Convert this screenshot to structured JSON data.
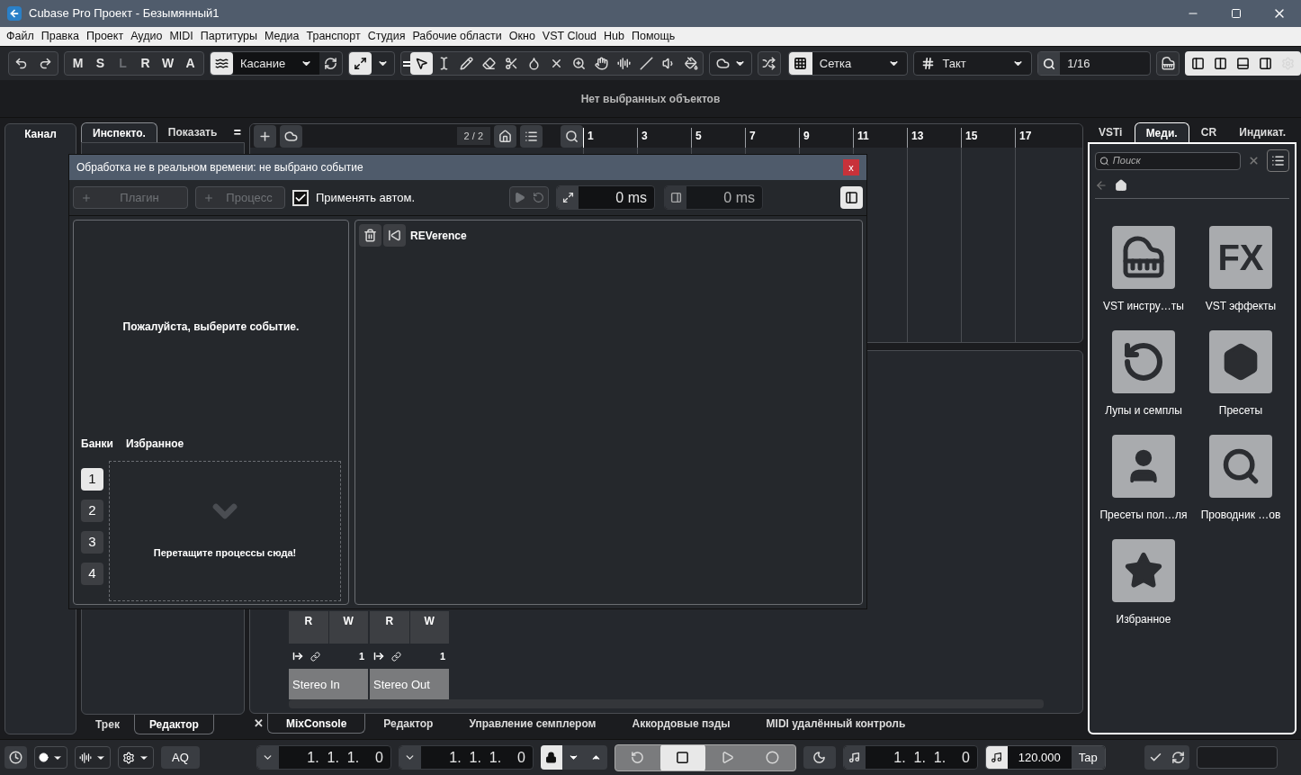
{
  "window": {
    "title": "Cubase Pro Проект - Безымянный1"
  },
  "menu": [
    "Файл",
    "Правка",
    "Проект",
    "Аудио",
    "MIDI",
    "Партитуры",
    "Медиа",
    "Транспорт",
    "Студия",
    "Рабочие области",
    "Окно",
    "VST Cloud",
    "Hub",
    "Помощь"
  ],
  "toolbar": {
    "modes": [
      {
        "label": "M",
        "disabled": false
      },
      {
        "label": "S",
        "disabled": false
      },
      {
        "label": "L",
        "disabled": true
      },
      {
        "label": "R",
        "disabled": false
      },
      {
        "label": "W",
        "disabled": false
      },
      {
        "label": "A",
        "disabled": false
      }
    ],
    "automation_mode": "Касание",
    "snap_type": "Сетка",
    "grid": "Такт",
    "quantize": "1/16"
  },
  "info_line": "Нет выбранных объектов",
  "channel_tab": "Канал",
  "inspector": {
    "tabs": [
      {
        "label": "Инспекто.",
        "selected": true
      },
      {
        "label": "Показать",
        "selected": false
      }
    ],
    "menu_glyph": "="
  },
  "left_zone_tabs": [
    {
      "label": "Трек",
      "selected": false
    },
    {
      "label": "Редактор",
      "selected": true
    }
  ],
  "project": {
    "track_count": "2 / 2",
    "ruler": [
      "1",
      "3",
      "5",
      "7",
      "9",
      "11",
      "13",
      "15",
      "17"
    ]
  },
  "mixer": {
    "strips": [
      {
        "name": "Stereo In",
        "read": "R",
        "write": "W",
        "channels": "1"
      },
      {
        "name": "Stereo Out",
        "read": "R",
        "write": "W",
        "channels": "1"
      }
    ]
  },
  "lower_zone": {
    "close_glyph": "✕",
    "tabs": [
      {
        "label": "MixConsole",
        "selected": true
      },
      {
        "label": "Редактор",
        "selected": false
      },
      {
        "label": "Управление семплером",
        "selected": false
      },
      {
        "label": "Аккордовые пэды",
        "selected": false
      },
      {
        "label": "MIDI удалённый контроль",
        "selected": false
      }
    ]
  },
  "media_bay": {
    "tabs": [
      {
        "label": "VSTi",
        "selected": false
      },
      {
        "label": "Меди.",
        "selected": true
      },
      {
        "label": "CR",
        "selected": false
      },
      {
        "label": "Индикат.",
        "selected": false
      }
    ],
    "search": {
      "placeholder": "Поиск"
    },
    "effects_glyph": "FX",
    "items": [
      {
        "kind": "instruments",
        "label": "VST инстру…ты"
      },
      {
        "kind": "effects",
        "label": "VST эффекты"
      },
      {
        "kind": "loops",
        "label": "Лупы и семплы"
      },
      {
        "kind": "presets",
        "label": "Пресеты"
      },
      {
        "kind": "user_presets",
        "label": "Пресеты пол…ля"
      },
      {
        "kind": "browser",
        "label": "Проводник …ов"
      },
      {
        "kind": "favorites",
        "label": "Избранное"
      }
    ]
  },
  "dialog": {
    "title": "Обработка не в реальном времени: не выбрано событие",
    "close_glyph": "x",
    "buttons": [
      {
        "label": "Плагин",
        "disabled": true
      },
      {
        "label": "Процесс",
        "disabled": true
      }
    ],
    "auto_apply": {
      "label": "Применять автом.",
      "checked": true
    },
    "pre_roll": "0 ms",
    "post_roll": "0 ms",
    "message": "Пожалуйста, выберите событие.",
    "bank_tabs": [
      "Банки",
      "Избранное"
    ],
    "banks": [
      {
        "label": "1",
        "selected": true
      },
      {
        "label": "2",
        "selected": false
      },
      {
        "label": "3",
        "selected": false
      },
      {
        "label": "4",
        "selected": false
      }
    ],
    "drop_hint": "Перетащите процессы сюда!",
    "plugins": [
      {
        "name": "REVerence"
      }
    ]
  },
  "transport": {
    "aq": "AQ",
    "left_locator": "1.  1.  1.    0",
    "right_locator": "1.  1.  1.    0",
    "position": "1.  1.  1.    0",
    "tempo": "120.000",
    "tap": "Tap"
  }
}
